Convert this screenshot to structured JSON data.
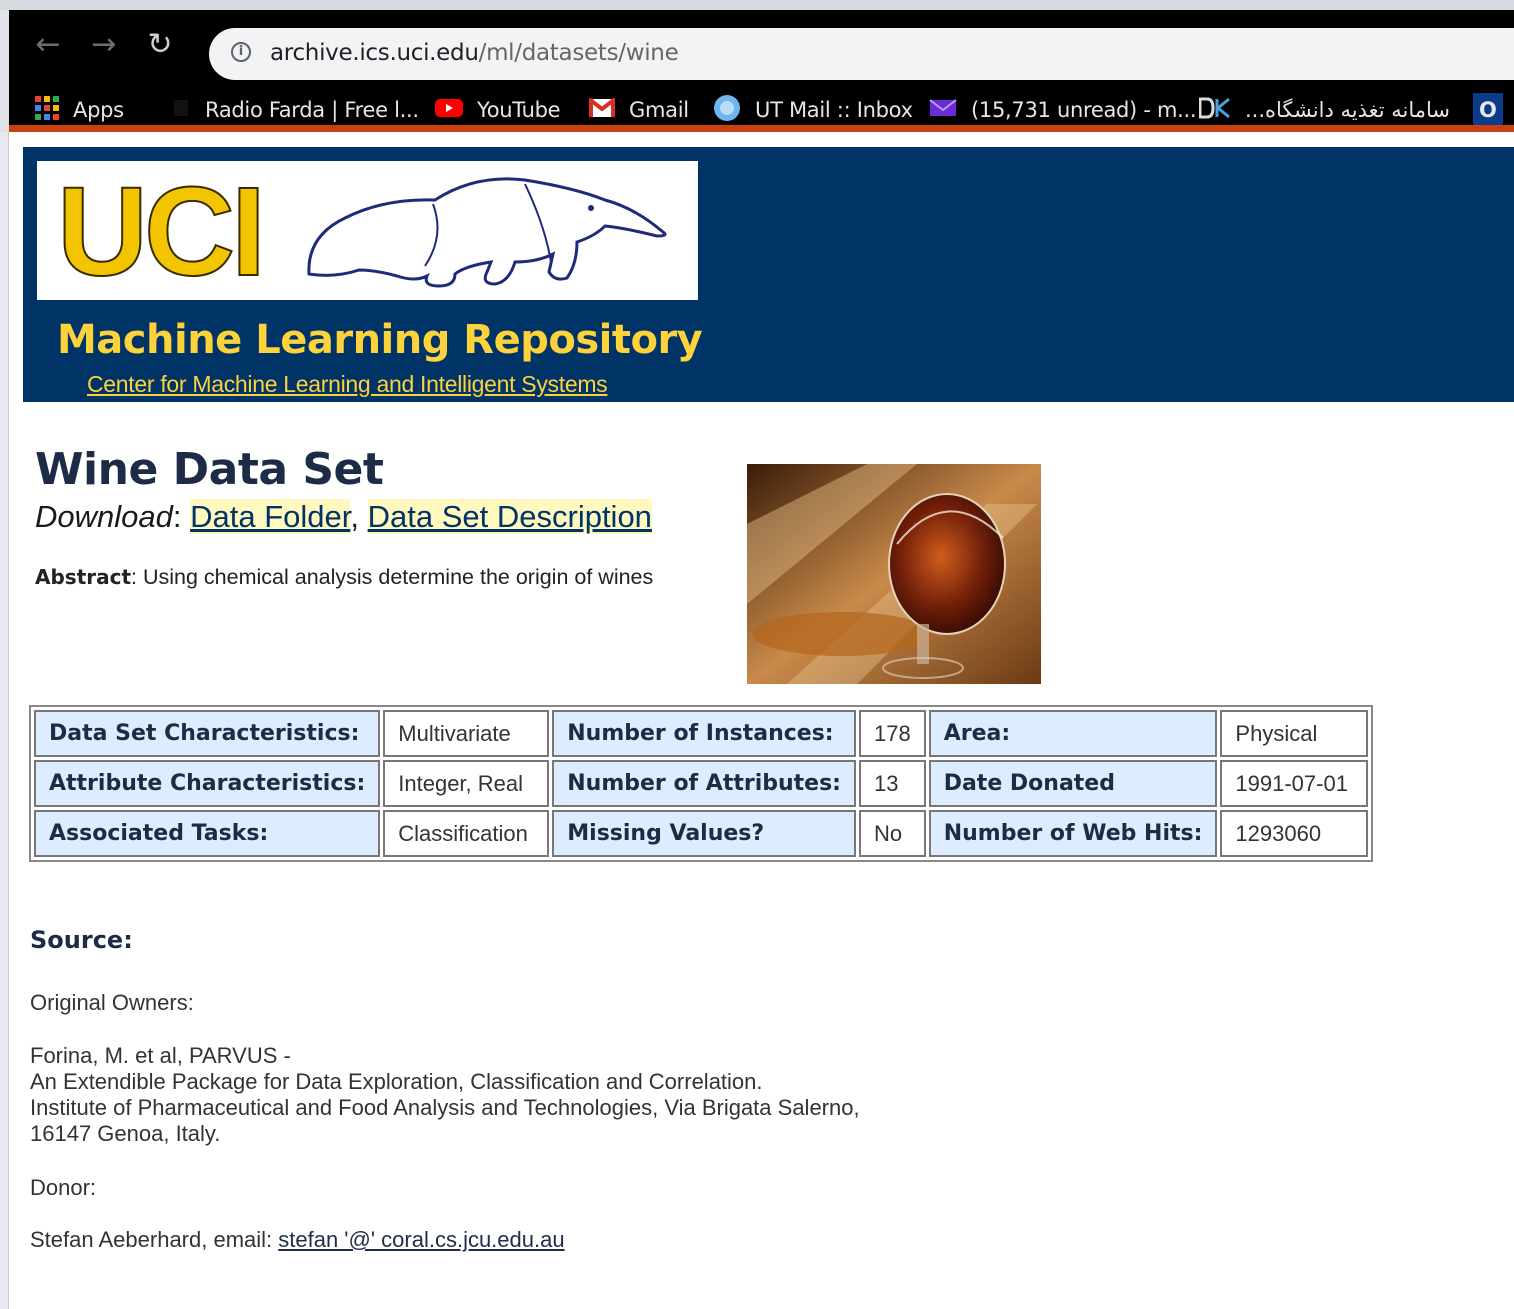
{
  "browser": {
    "url_host": "archive.ics.uci.edu",
    "url_path": "/ml/datasets/wine",
    "bookmarks": [
      {
        "label": "Apps",
        "icon": "apps-grid-icon"
      },
      {
        "label": "Radio Farda | Free l...",
        "icon": "radio-farda-icon"
      },
      {
        "label": "YouTube",
        "icon": "youtube-icon"
      },
      {
        "label": "Gmail",
        "icon": "gmail-icon"
      },
      {
        "label": "UT Mail :: Inbox",
        "icon": "ut-mail-icon"
      },
      {
        "label": "(15,731 unread) - m...",
        "icon": "yahoo-mail-icon"
      },
      {
        "label": "...سامانه تغذیه دانشگاه",
        "icon": "dk-icon"
      },
      {
        "label": "O",
        "icon": "o-icon"
      }
    ]
  },
  "banner": {
    "logo_text": "UCI",
    "repo_title": "Machine Learning Repository",
    "center_link": "Center for Machine Learning and Intelligent Systems"
  },
  "dataset": {
    "title": "Wine Data Set",
    "download_label": "Download",
    "link_data_folder": "Data Folder",
    "link_description": "Data Set Description",
    "abstract_label": "Abstract",
    "abstract_text": ": Using chemical analysis determine the origin of wines"
  },
  "characteristics": {
    "rows": [
      [
        "Data Set Characteristics:",
        "Multivariate",
        "Number of Instances:",
        "178",
        "Area:",
        "Physical"
      ],
      [
        "Attribute Characteristics:",
        "Integer, Real",
        "Number of Attributes:",
        "13",
        "Date Donated",
        "1991-07-01"
      ],
      [
        "Associated Tasks:",
        "Classification",
        "Missing Values?",
        "No",
        "Number of Web Hits:",
        "1293060"
      ]
    ]
  },
  "source": {
    "heading": "Source:",
    "owners_label": "Original Owners:",
    "owner_lines": [
      "Forina, M. et al, PARVUS -",
      "An Extendible Package for Data Exploration, Classification and Correlation.",
      "Institute of Pharmaceutical and Food Analysis and Technologies, Via Brigata Salerno,",
      "16147 Genoa, Italy."
    ],
    "donor_label": "Donor:",
    "donor_prefix": "Stefan Aeberhard, email: ",
    "donor_email": "stefan '@' coral.cs.jcu.edu.au"
  }
}
